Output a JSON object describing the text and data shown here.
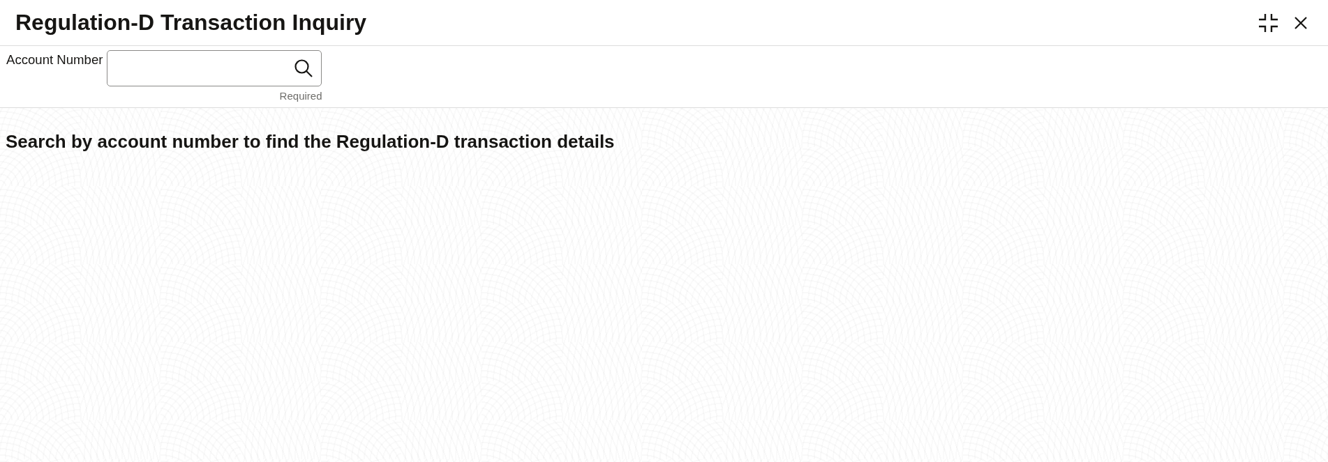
{
  "window": {
    "title": "Regulation-D Transaction Inquiry"
  },
  "search_form": {
    "label": "Account Number",
    "helper_text": "Required"
  },
  "message": "Search by account number to find the Regulation-D transaction details"
}
